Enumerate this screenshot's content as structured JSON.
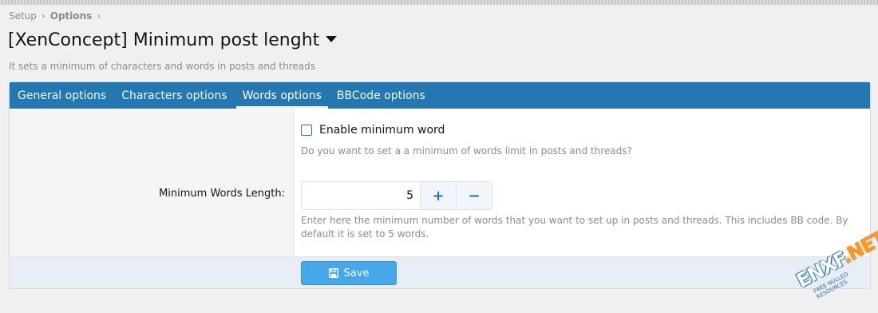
{
  "breadcrumb": {
    "item1": "Setup",
    "item2": "Options",
    "sep": "›"
  },
  "page": {
    "title": "[XenConcept] Minimum post lenght",
    "description": "It sets a minimum of characters and words in posts and threads"
  },
  "tabs": [
    {
      "label": "General options",
      "active": false
    },
    {
      "label": "Characters options",
      "active": false
    },
    {
      "label": "Words options",
      "active": true
    },
    {
      "label": "BBCode options",
      "active": false
    }
  ],
  "form": {
    "checkbox_label": "Enable minimum word",
    "checkbox_checked": false,
    "checkbox_hint": "Do you want to set a a minimum of words limit in posts and threads?",
    "min_words_label": "Minimum Words Length:",
    "min_words_value": "5",
    "plus_label": "+",
    "minus_label": "−",
    "min_words_hint": "Enter here the minimum number of words that you want to set up in posts and threads. This includes BB code. By default it is set to 5 words.",
    "save_label": "Save"
  },
  "watermark": {
    "text": "ENXF",
    "dot": ".NET",
    "tagline": "FREE NULLED RESOURCES"
  },
  "colors": {
    "accent": "#2577b1",
    "button": "#47a7eb",
    "background": "#f0f0f1"
  }
}
